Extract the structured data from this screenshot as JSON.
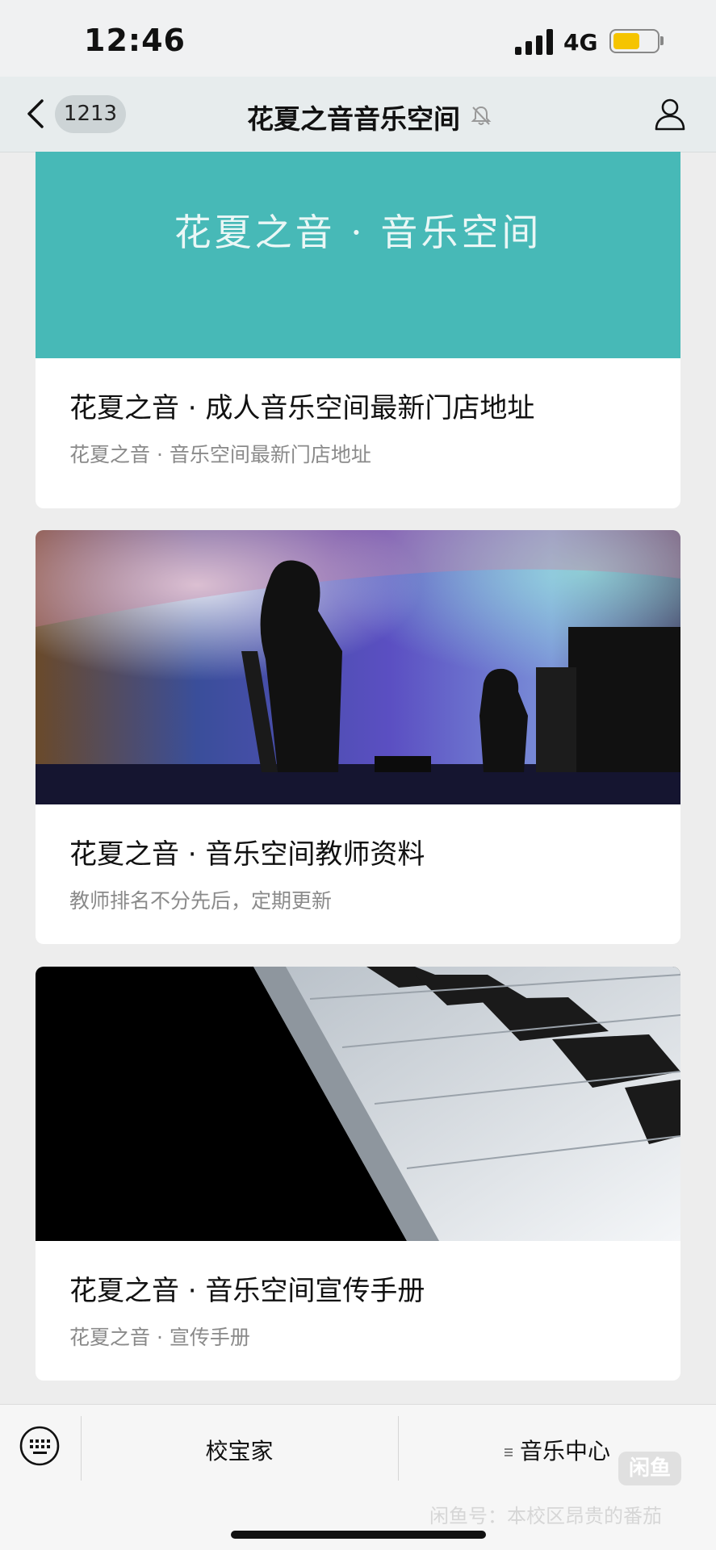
{
  "status_bar": {
    "time": "12:46",
    "network": "4G",
    "battery_level": 0.62
  },
  "nav": {
    "unread_count": "1213",
    "title": "花夏之音音乐空间"
  },
  "cards": [
    {
      "banner_text": "花夏之音 · 音乐空间",
      "title": "花夏之音 · 成人音乐空间最新门店地址",
      "subtitle": "花夏之音 · 音乐空间最新门店地址"
    },
    {
      "title": "花夏之音 · 音乐空间教师资料",
      "subtitle": "教师排名不分先后，定期更新"
    },
    {
      "title": "花夏之音 · 音乐空间宣传手册",
      "subtitle": "花夏之音 · 宣传手册"
    }
  ],
  "bottom_menu": {
    "item1": "校宝家",
    "item2": "音乐中心"
  },
  "watermark": {
    "logo": "闲鱼",
    "text": "闲鱼号：本校区昂贵的番茄"
  },
  "colors": {
    "banner_teal": "#47b9b7",
    "battery": "#f5c400"
  }
}
